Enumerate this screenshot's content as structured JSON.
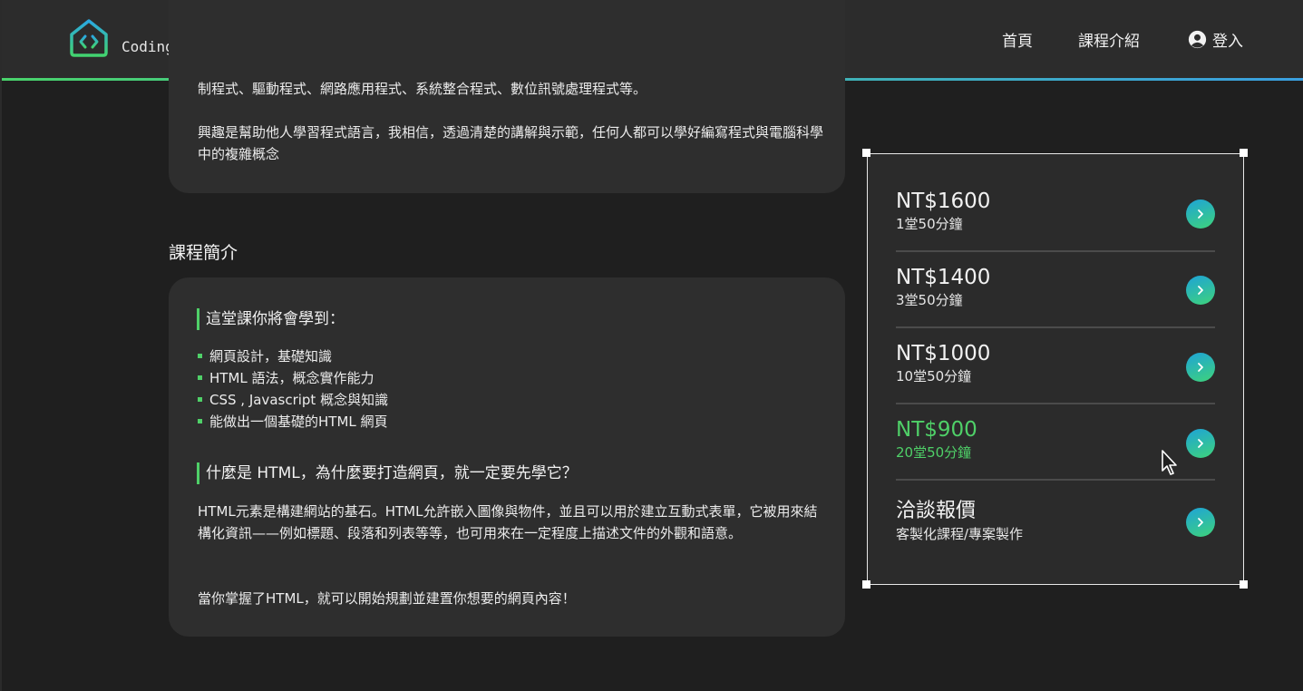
{
  "header": {
    "brand": "Coding Home",
    "nav": {
      "home": "首頁",
      "course": "課程介紹",
      "login": "登入"
    }
  },
  "about": {
    "p1": "制程式、驅動程式、網路應用程式、系統整合程式、數位訊號處理程式等。",
    "p2": "興趣是幫助他人學習程式語言，我相信，透過清楚的講解與示範，任何人都可以學好編寫程式與電腦科學中的複雜概念"
  },
  "intro": {
    "section_title": "課程簡介",
    "learn_heading": "這堂課你將會學到：",
    "learn_items": [
      "網頁設計，基礎知識",
      "HTML 語法，概念實作能力",
      "CSS , Javascript 概念與知識",
      "能做出一個基礎的HTML 網頁"
    ],
    "what_heading": "什麼是 HTML，為什麼要打造網頁，就一定要先學它？",
    "what_p1": "HTML元素是構建網站的基石。HTML允許嵌入圖像與物件，並且可以用於建立互動式表單，它被用來結構化資訊——例如標題、段落和列表等等，也可用來在一定程度上描述文件的外觀和語意。",
    "what_p2": "當你掌握了HTML，就可以開始規劃並建置你想要的網頁內容！"
  },
  "pricing": {
    "accent_color": "#4fd068",
    "options": [
      {
        "price": "NT$1600",
        "desc": "1堂50分鐘",
        "active": false
      },
      {
        "price": "NT$1400",
        "desc": "3堂50分鐘",
        "active": false
      },
      {
        "price": "NT$1000",
        "desc": "10堂50分鐘",
        "active": false
      },
      {
        "price": "NT$900",
        "desc": "20堂50分鐘",
        "active": true
      },
      {
        "price": "洽談報價",
        "desc": "客製化課程/專案製作",
        "active": false
      }
    ]
  }
}
